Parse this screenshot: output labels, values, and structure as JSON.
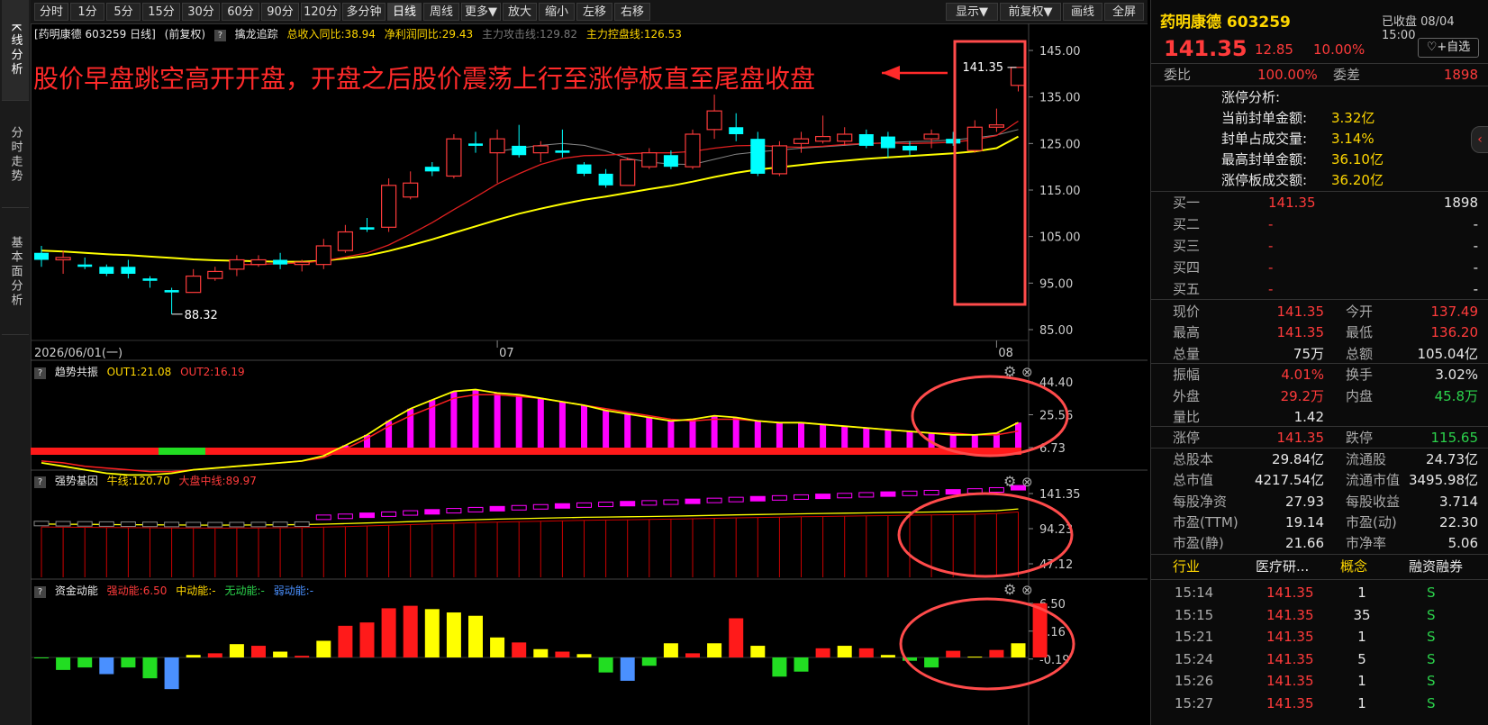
{
  "left_tabs": [
    {
      "label": "K线分析",
      "active": true
    },
    {
      "label": "分时走势",
      "active": false
    },
    {
      "label": "基本面分析",
      "active": false
    }
  ],
  "toolbar": {
    "left_buttons": [
      "分时",
      "1分",
      "5分",
      "15分",
      "30分",
      "60分",
      "90分",
      "120分",
      "多分钟",
      "日线",
      "周线",
      "更多▼",
      "放大",
      "缩小",
      "左移",
      "右移"
    ],
    "active": "日线",
    "right_buttons": [
      "显示▼",
      "前复权▼",
      "画线",
      "全屏"
    ]
  },
  "main_info": {
    "stock_label": "[药明康德 603259 日线]",
    "adj": "(前复权)",
    "indicator": "擒龙追踪",
    "rev_yoy": "总收入同比:38.94",
    "profit_yoy": "净利润同比:29.43",
    "attack_line": "主力攻击线:129.82",
    "control_line": "主力控盘线:126.53"
  },
  "annotation": "股价早盘跳空高开开盘，开盘之后股价震荡上行至涨停板直至尾盘收盘",
  "price_chart": {
    "y_ticks": [
      "145.00",
      "135.00",
      "125.00",
      "115.00",
      "105.00",
      "95.00",
      "85.00"
    ],
    "x_labels": [
      "2026/06/01(一)",
      "07",
      "08"
    ],
    "high_label": "141.35",
    "low_label": "88.32"
  },
  "panels": {
    "trend": {
      "name": "趋势共振",
      "out1": "OUT1:21.08",
      "out2": "OUT2:16.19",
      "ticks": [
        "44.40",
        "25.56",
        "6.73"
      ]
    },
    "gene": {
      "name": "强势基因",
      "bull": "牛线:120.70",
      "market": "大盘中线:89.97",
      "ticks": [
        "141.35",
        "94.23",
        "47.12"
      ]
    },
    "fund": {
      "name": "资金动能",
      "strong": "强动能:6.50",
      "mid": "中动能:-",
      "none": "无动能:-",
      "weak": "弱动能:-",
      "ticks": [
        "6.50",
        "3.16",
        "-0.19"
      ]
    }
  },
  "quote": {
    "name": "药明康德 603259",
    "status": "已收盘 08/04 15:00",
    "price": "141.35",
    "change": "12.85",
    "pct": "10.00%",
    "watch_btn": "+自选",
    "weibi_label": "委比",
    "weibi": "100.00%",
    "weicha_label": "委差",
    "weicha": "1898",
    "limit_analysis": {
      "title": "涨停分析:",
      "rows": [
        {
          "label": "当前封单金额:",
          "value": "3.32亿"
        },
        {
          "label": "封单占成交量:",
          "value": "3.14%"
        },
        {
          "label": "最高封单金额:",
          "value": "36.10亿"
        },
        {
          "label": "涨停板成交额:",
          "value": "36.20亿"
        }
      ]
    },
    "book": [
      {
        "label": "买一",
        "price": "141.35",
        "vol": "1898"
      },
      {
        "label": "买二",
        "price": "-",
        "vol": "-"
      },
      {
        "label": "买三",
        "price": "-",
        "vol": "-"
      },
      {
        "label": "买四",
        "price": "-",
        "vol": "-"
      },
      {
        "label": "买五",
        "price": "-",
        "vol": "-"
      }
    ],
    "stats": [
      [
        {
          "l": "现价",
          "v": "141.35",
          "c": "red"
        },
        {
          "l": "今开",
          "v": "137.49",
          "c": "red"
        }
      ],
      [
        {
          "l": "最高",
          "v": "141.35",
          "c": "red"
        },
        {
          "l": "最低",
          "v": "136.20",
          "c": "red"
        }
      ],
      [
        {
          "l": "总量",
          "v": "75万",
          "c": "wht"
        },
        {
          "l": "总额",
          "v": "105.04亿",
          "c": "wht"
        }
      ],
      [
        {
          "l": "振幅",
          "v": "4.01%",
          "c": "red"
        },
        {
          "l": "换手",
          "v": "3.02%",
          "c": "wht"
        }
      ],
      [
        {
          "l": "外盘",
          "v": "29.2万",
          "c": "red"
        },
        {
          "l": "内盘",
          "v": "45.8万",
          "c": "grn"
        }
      ],
      [
        {
          "l": "量比",
          "v": "1.42",
          "c": "wht"
        },
        {
          "l": "",
          "v": "",
          "c": "wht"
        }
      ],
      [
        {
          "l": "涨停",
          "v": "141.35",
          "c": "red"
        },
        {
          "l": "跌停",
          "v": "115.65",
          "c": "grn"
        }
      ],
      [
        {
          "l": "总股本",
          "v": "29.84亿",
          "c": "wht"
        },
        {
          "l": "流通股",
          "v": "24.73亿",
          "c": "wht"
        }
      ],
      [
        {
          "l": "总市值",
          "v": "4217.54亿",
          "c": "wht"
        },
        {
          "l": "流通市值",
          "v": "3495.98亿",
          "c": "wht"
        }
      ],
      [
        {
          "l": "每股净资",
          "v": "27.93",
          "c": "wht"
        },
        {
          "l": "每股收益",
          "v": "3.714",
          "c": "wht"
        }
      ],
      [
        {
          "l": "市盈(TTM)",
          "v": "19.14",
          "c": "wht"
        },
        {
          "l": "市盈(动)",
          "v": "22.30",
          "c": "wht"
        }
      ],
      [
        {
          "l": "市盈(静)",
          "v": "21.66",
          "c": "wht"
        },
        {
          "l": "市净率",
          "v": "5.06",
          "c": "wht"
        }
      ]
    ],
    "tags": {
      "industry_label": "行业",
      "industry": "医疗研...",
      "concept_label": "概念",
      "margin": "融资融券"
    },
    "ticks": [
      {
        "t": "15:14",
        "p": "141.35",
        "v": "1",
        "s": "S"
      },
      {
        "t": "15:15",
        "p": "141.35",
        "v": "35",
        "s": "S"
      },
      {
        "t": "15:21",
        "p": "141.35",
        "v": "1",
        "s": "S"
      },
      {
        "t": "15:24",
        "p": "141.35",
        "v": "5",
        "s": "S"
      },
      {
        "t": "15:26",
        "p": "141.35",
        "v": "1",
        "s": "S"
      },
      {
        "t": "15:27",
        "p": "141.35",
        "v": "1",
        "s": "S"
      }
    ]
  },
  "chart_data": {
    "type": "candlestick",
    "dates_axis_labels": [
      "2026/06/01(一)",
      "07",
      "08"
    ],
    "ylim": [
      85,
      145
    ],
    "candles": [
      {
        "o": 101.5,
        "c": 100.0,
        "h": 103.0,
        "l": 98.5
      },
      {
        "o": 100.0,
        "c": 100.5,
        "h": 102.0,
        "l": 97.0
      },
      {
        "o": 99.0,
        "c": 98.5,
        "h": 100.5,
        "l": 98.0
      },
      {
        "o": 98.5,
        "c": 97.0,
        "h": 99.0,
        "l": 96.5
      },
      {
        "o": 98.5,
        "c": 97.0,
        "h": 100.0,
        "l": 96.0
      },
      {
        "o": 96.0,
        "c": 95.5,
        "h": 96.5,
        "l": 94.0
      },
      {
        "o": 93.5,
        "c": 93.0,
        "h": 94.0,
        "l": 88.32
      },
      {
        "o": 93.0,
        "c": 96.5,
        "h": 98.0,
        "l": 93.0
      },
      {
        "o": 96.0,
        "c": 97.5,
        "h": 98.5,
        "l": 95.5
      },
      {
        "o": 98.0,
        "c": 100.0,
        "h": 101.0,
        "l": 96.5
      },
      {
        "o": 99.0,
        "c": 100.0,
        "h": 101.0,
        "l": 98.5
      },
      {
        "o": 100.0,
        "c": 99.0,
        "h": 101.5,
        "l": 98.0
      },
      {
        "o": 99.0,
        "c": 99.5,
        "h": 100.0,
        "l": 97.5
      },
      {
        "o": 99.0,
        "c": 103.0,
        "h": 104.5,
        "l": 98.0
      },
      {
        "o": 102.0,
        "c": 106.0,
        "h": 107.5,
        "l": 101.5
      },
      {
        "o": 107.0,
        "c": 106.5,
        "h": 109.0,
        "l": 106.0
      },
      {
        "o": 107.0,
        "c": 116.0,
        "h": 117.5,
        "l": 106.0
      },
      {
        "o": 113.5,
        "c": 116.5,
        "h": 119.0,
        "l": 113.0
      },
      {
        "o": 120.0,
        "c": 119.0,
        "h": 121.0,
        "l": 118.0
      },
      {
        "o": 118.0,
        "c": 126.0,
        "h": 127.0,
        "l": 117.5
      },
      {
        "o": 125.0,
        "c": 124.5,
        "h": 127.5,
        "l": 123.0
      },
      {
        "o": 123.0,
        "c": 126.0,
        "h": 128.0,
        "l": 116.5
      },
      {
        "o": 124.5,
        "c": 122.5,
        "h": 129.0,
        "l": 122.0
      },
      {
        "o": 123.0,
        "c": 124.5,
        "h": 125.5,
        "l": 121.0
      },
      {
        "o": 123.5,
        "c": 123.0,
        "h": 128.0,
        "l": 122.0
      },
      {
        "o": 120.5,
        "c": 118.5,
        "h": 121.0,
        "l": 118.0
      },
      {
        "o": 118.5,
        "c": 116.0,
        "h": 119.5,
        "l": 115.5
      },
      {
        "o": 116.0,
        "c": 121.5,
        "h": 122.0,
        "l": 116.0
      },
      {
        "o": 120.0,
        "c": 123.0,
        "h": 124.0,
        "l": 119.5
      },
      {
        "o": 122.5,
        "c": 120.0,
        "h": 123.5,
        "l": 119.5
      },
      {
        "o": 120.0,
        "c": 127.0,
        "h": 128.0,
        "l": 119.5
      },
      {
        "o": 128.0,
        "c": 132.0,
        "h": 135.5,
        "l": 126.0
      },
      {
        "o": 128.5,
        "c": 127.0,
        "h": 131.5,
        "l": 125.5
      },
      {
        "o": 126.0,
        "c": 118.5,
        "h": 127.5,
        "l": 118.0
      },
      {
        "o": 118.5,
        "c": 124.5,
        "h": 125.5,
        "l": 118.0
      },
      {
        "o": 125.0,
        "c": 126.0,
        "h": 127.5,
        "l": 123.0
      },
      {
        "o": 125.5,
        "c": 126.5,
        "h": 131.0,
        "l": 125.0
      },
      {
        "o": 125.5,
        "c": 127.0,
        "h": 128.5,
        "l": 124.5
      },
      {
        "o": 127.0,
        "c": 124.5,
        "h": 128.0,
        "l": 124.0
      },
      {
        "o": 126.5,
        "c": 124.0,
        "h": 127.5,
        "l": 122.0
      },
      {
        "o": 124.5,
        "c": 123.5,
        "h": 125.5,
        "l": 122.5
      },
      {
        "o": 126.0,
        "c": 127.0,
        "h": 128.0,
        "l": 124.0
      },
      {
        "o": 126.0,
        "c": 125.0,
        "h": 127.5,
        "l": 124.5
      },
      {
        "o": 123.5,
        "c": 128.5,
        "h": 130.0,
        "l": 123.0
      },
      {
        "o": 128.5,
        "c": 129.0,
        "h": 132.5,
        "l": 127.5
      },
      {
        "o": 137.49,
        "c": 141.35,
        "h": 141.35,
        "l": 136.2
      }
    ],
    "ma_red": [
      null,
      null,
      null,
      null,
      null,
      null,
      null,
      null,
      null,
      99.0,
      99.0,
      99.2,
      99.3,
      99.8,
      100.6,
      101.5,
      103.2,
      105.5,
      108.0,
      110.8,
      113.5,
      116.3,
      118.5,
      120.5,
      121.8,
      122.4,
      122.5,
      122.8,
      123.0,
      123.0,
      123.3,
      124.0,
      124.5,
      124.6,
      124.3,
      124.2,
      124.4,
      124.8,
      125.0,
      125.1,
      125.0,
      125.1,
      125.3,
      125.8,
      126.7,
      129.8
    ],
    "ma_yellow": [
      102.0,
      101.8,
      101.5,
      101.2,
      101.0,
      100.7,
      100.4,
      100.1,
      99.9,
      99.8,
      99.7,
      99.6,
      99.6,
      99.8,
      100.3,
      100.9,
      101.9,
      103.1,
      104.4,
      105.8,
      107.2,
      108.6,
      109.9,
      111.0,
      112.0,
      112.9,
      113.6,
      114.4,
      115.2,
      115.9,
      116.8,
      117.8,
      118.7,
      119.4,
      119.9,
      120.4,
      120.9,
      121.3,
      121.7,
      122.0,
      122.3,
      122.6,
      122.9,
      123.3,
      124.0,
      126.5
    ],
    "ma_gray": [
      null,
      null,
      null,
      null,
      null,
      null,
      null,
      null,
      null,
      null,
      null,
      null,
      null,
      null,
      null,
      null,
      null,
      null,
      null,
      null,
      null,
      123.3,
      124.0,
      124.6,
      125.0,
      124.6,
      123.4,
      121.8,
      121.0,
      120.6,
      120.5,
      121.6,
      122.7,
      123.2,
      123.6,
      124.0,
      124.3,
      124.6,
      124.9,
      125.2,
      125.4,
      125.5,
      125.8,
      126.2,
      126.8,
      128.0
    ],
    "trend_bars": [
      0,
      0,
      0,
      0,
      0,
      0,
      0,
      0,
      0,
      0,
      0,
      0,
      0,
      2,
      8,
      14,
      22,
      29,
      34,
      39,
      40,
      38,
      37,
      35,
      33,
      31,
      28,
      26,
      24,
      22,
      23,
      25,
      24,
      22,
      21,
      21,
      20,
      19,
      18,
      17,
      16,
      15,
      14,
      14,
      15,
      21.08
    ],
    "trend_out1": [
      -2,
      -4,
      -6,
      -8,
      -9,
      -9,
      -8,
      -6,
      -5,
      -4,
      -3,
      -2,
      -1,
      2,
      8,
      14,
      22,
      29,
      34,
      39,
      40,
      38,
      37,
      35,
      33,
      31,
      28,
      26,
      24,
      22,
      23,
      25,
      24,
      22,
      21,
      21,
      20,
      19,
      18,
      17,
      16,
      15,
      14,
      14,
      15,
      21.08
    ],
    "trend_out2": [
      -1,
      -2,
      -4,
      -5,
      -6,
      -7,
      -7,
      -6,
      -5,
      -4,
      -3,
      -2,
      -1,
      1,
      6,
      12,
      19,
      25,
      30,
      35,
      37,
      37,
      36,
      35,
      33,
      31,
      29,
      27,
      25,
      23,
      22,
      23,
      23,
      22,
      21,
      21,
      20,
      19,
      18,
      17,
      16,
      15,
      15,
      14,
      14,
      16.19
    ],
    "gene_bull": [
      100.5,
      100.2,
      100.0,
      99.8,
      99.6,
      99.4,
      99.2,
      99.1,
      99.0,
      99.1,
      99.2,
      99.4,
      99.7,
      100.3,
      101.0,
      101.8,
      102.7,
      103.7,
      104.6,
      105.5,
      106.3,
      107.0,
      107.7,
      108.3,
      108.9,
      109.4,
      109.8,
      110.2,
      110.6,
      111.0,
      111.5,
      112.1,
      112.7,
      113.2,
      113.7,
      114.2,
      114.6,
      115.0,
      115.4,
      115.8,
      116.2,
      116.6,
      117.0,
      117.6,
      118.4,
      120.7
    ],
    "fund_bars": [
      -0.1,
      -1.5,
      -1.2,
      -2.0,
      -1.2,
      -2.5,
      -3.8,
      0.3,
      0.5,
      1.6,
      1.4,
      0.7,
      0.2,
      2.0,
      3.8,
      4.2,
      5.9,
      6.2,
      5.8,
      5.4,
      5.0,
      2.4,
      1.8,
      1.0,
      0.7,
      0.4,
      -1.8,
      -2.8,
      -1.0,
      1.7,
      0.5,
      1.7,
      4.7,
      1.4,
      -2.3,
      -1.7,
      1.1,
      1.4,
      1.1,
      0.3,
      -0.4,
      -1.2,
      0.8,
      0.1,
      0.9,
      1.7,
      6.5
    ]
  }
}
